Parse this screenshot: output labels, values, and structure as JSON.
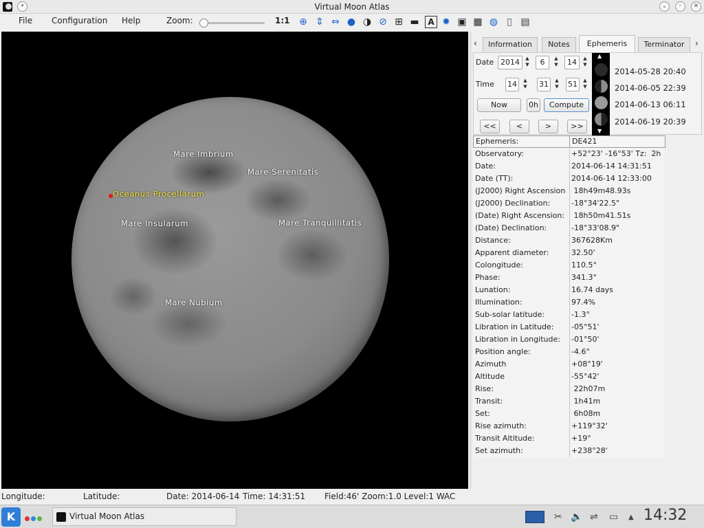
{
  "window": {
    "title": "Virtual Moon Atlas"
  },
  "menu": {
    "file": "File",
    "configuration": "Configuration",
    "help": "Help"
  },
  "toolbar": {
    "zoom_label": "Zoom:",
    "zoom_level": 0,
    "one_to_one": "1:1"
  },
  "map": {
    "labels": {
      "imbrium": "Mare Imbrium",
      "serenitatis": "Mare Serenitatis",
      "procellarum": "Oceanus Procellarum",
      "insularum": "Mare Insularum",
      "tranquillitatis": "Mare Tranquillitatis",
      "nubium": "Mare Nubium"
    }
  },
  "panel": {
    "tabs": {
      "information": "Information",
      "notes": "Notes",
      "ephemeris": "Ephemeris",
      "terminator": "Terminator"
    },
    "active_tab": "Ephemeris",
    "date_label": "Date",
    "time_label": "Time",
    "date": {
      "year": "2014",
      "month": "6",
      "day": "14"
    },
    "time": {
      "hour": "14",
      "minute": "31",
      "second": "51"
    },
    "buttons": {
      "now": "Now",
      "zero_h": "0h",
      "compute": "Compute",
      "first": "<<",
      "prev": "<",
      "next": ">",
      "last": ">>"
    },
    "phases": [
      "2014-05-28 20:40",
      "2014-06-05 22:39",
      "2014-06-13 06:11",
      "2014-06-19 20:39"
    ],
    "ephemeris_header": {
      "key": "Ephemeris:",
      "value": "DE421"
    },
    "rows": [
      {
        "k": "Observatory:",
        "v": "+52°23' -16°53' Tz:  2h"
      },
      {
        "k": "Date:",
        "v": "2014-06-14 14:31:51"
      },
      {
        "k": "Date (TT):",
        "v": "2014-06-14 12:33:00"
      },
      {
        "k": "(J2000) Right Ascension",
        "v": " 18h49m48.93s"
      },
      {
        "k": "(J2000) Declination:",
        "v": "-18°34'22.5\""
      },
      {
        "k": "(Date) Right Ascension:",
        "v": " 18h50m41.51s"
      },
      {
        "k": "(Date) Declination:",
        "v": "-18°33'08.9\""
      },
      {
        "k": "Distance:",
        "v": "367628Km"
      },
      {
        "k": "Apparent diameter:",
        "v": "32.50'"
      },
      {
        "k": "Colongitude:",
        "v": "110.5°"
      },
      {
        "k": "Phase:",
        "v": "341.3°"
      },
      {
        "k": "Lunation:",
        "v": "16.74 days"
      },
      {
        "k": "Illumination:",
        "v": "97.4%"
      },
      {
        "k": "Sub-solar latitude:",
        "v": "-1.3°"
      },
      {
        "k": "Libration in Latitude:",
        "v": "-05°51'"
      },
      {
        "k": "Libration in Longitude:",
        "v": "-01°50'"
      },
      {
        "k": "Position angle:",
        "v": "-4.6°"
      },
      {
        "k": "Azimuth",
        "v": "+08°19'"
      },
      {
        "k": "Altitude",
        "v": "-55°42'"
      },
      {
        "k": "Rise:",
        "v": " 22h07m"
      },
      {
        "k": "Transit:",
        "v": " 1h41m"
      },
      {
        "k": "Set:",
        "v": " 6h08m"
      },
      {
        "k": "Rise azimuth:",
        "v": "+119°32'"
      },
      {
        "k": "Transit Altitude:",
        "v": "+19°"
      },
      {
        "k": "Set azimuth:",
        "v": "+238°28'"
      }
    ]
  },
  "status": {
    "longitude": "Longitude:",
    "latitude": "Latitude:",
    "date": "Date: 2014-06-14",
    "time": "Time: 14:31:51",
    "field": "Field:46' Zoom:1.0  Level:1 WAC"
  },
  "taskbar": {
    "task_title": "Virtual Moon Atlas",
    "clock": "14:32"
  },
  "colors": {
    "accent": "#1b62c7",
    "highlight_label": "#ffeb3b",
    "marker": "#e21b1b"
  },
  "icons": [
    "crosshair-icon",
    "flip-vertical-icon",
    "flip-horizontal-icon",
    "globe-icon",
    "phase-icon",
    "orbit-icon",
    "grid-icon",
    "ruler-icon",
    "text-icon",
    "settings-icon",
    "camera-icon",
    "calendar-icon",
    "earth-icon",
    "document-icon",
    "window-icon"
  ]
}
